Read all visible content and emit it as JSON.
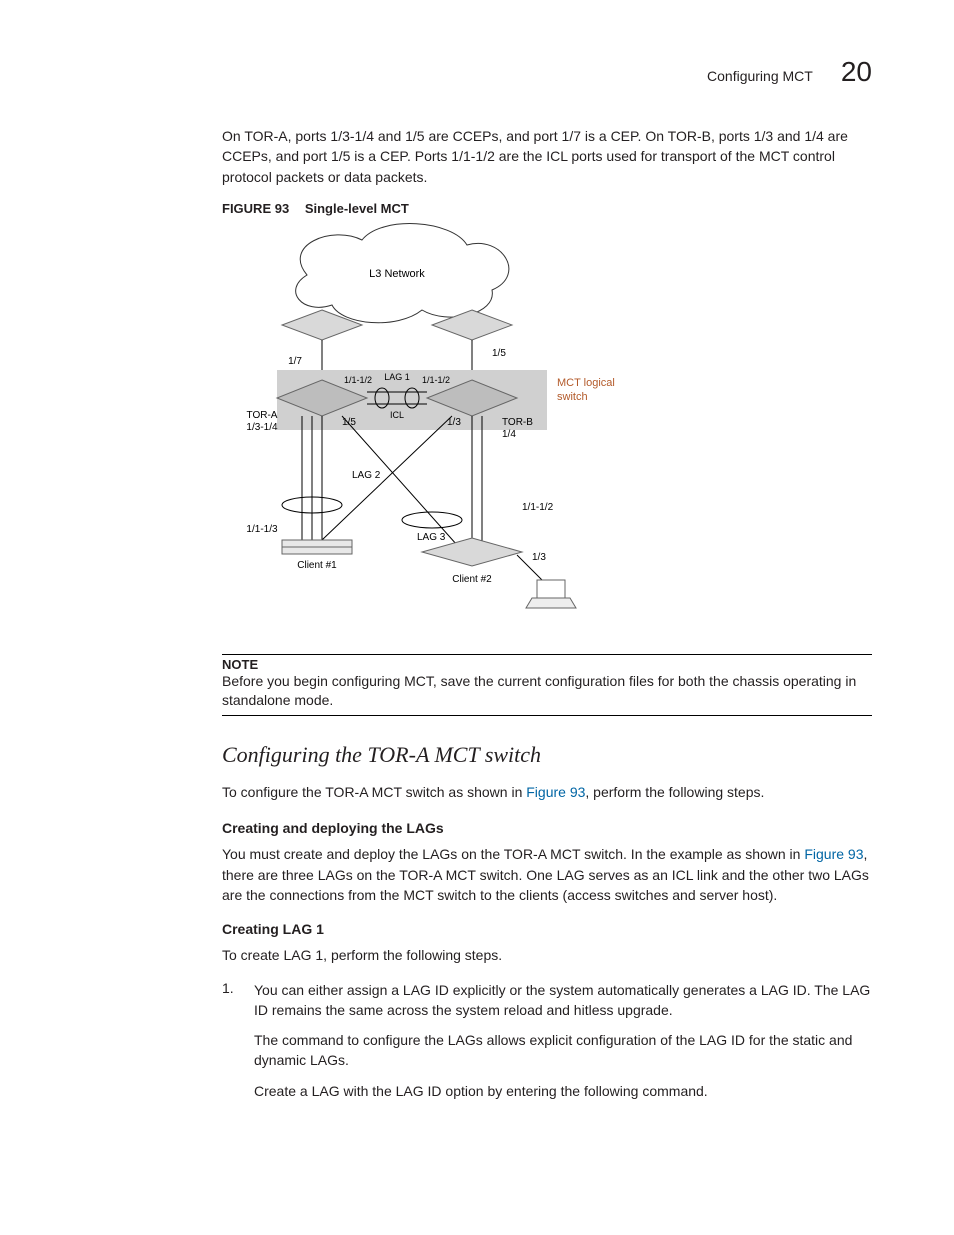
{
  "header": {
    "section_title": "Configuring MCT",
    "chapter_number": "20"
  },
  "intro_para": "On TOR-A, ports 1/3-1/4 and 1/5 are CCEPs, and port 1/7 is a CEP. On TOR-B, ports 1/3 and 1/4 are CCEPs, and port 1/5 is a CEP. Ports 1/1-1/2 are the ICL ports used for transport of the MCT control protocol packets or data packets.",
  "figure": {
    "label": "FIGURE 93",
    "title": "Single-level MCT",
    "labels": {
      "l3": "L3 Network",
      "p17": "1/7",
      "p15_top": "1/5",
      "icl_left": "1/1-1/2",
      "icl_right": "1/1-1/2",
      "lag1": "LAG 1",
      "icl": "ICL",
      "mct_logical": "MCT logical switch",
      "tor_a": "TOR-A",
      "tor_a_ports": "1/3-1/4",
      "p15_left": "1/5",
      "p13": "1/3",
      "tor_b": "TOR-B",
      "tor_b_port": "1/4",
      "lag2": "LAG 2",
      "lag3": "LAG 3",
      "c1_ports": "1/1-1/3",
      "c2_ports": "1/1-1/2",
      "p13_host": "1/3",
      "client1": "Client #1",
      "client2": "Client #2"
    }
  },
  "note": {
    "label": "NOTE",
    "text": "Before you begin configuring MCT, save the current configuration files for both the chassis operating in standalone mode."
  },
  "h2": "Configuring the TOR-A MCT switch",
  "h2_para_pre": "To configure the TOR-A MCT switch as shown in ",
  "h2_para_link": "Figure 93",
  "h2_para_post": ", perform the following steps.",
  "h3": "Creating and deploying the LAGs",
  "h3_para_pre": "You must create and deploy the LAGs on the TOR-A MCT switch. In the example as shown in ",
  "h3_para_link": "Figure 93",
  "h3_para_post": ", there are three LAGs on the TOR-A MCT switch. One LAG serves as an ICL link and the other two LAGs are the connections from the MCT switch to the clients (access switches and server host).",
  "h4": "Creating LAG 1",
  "h4_para": "To create LAG 1, perform the following steps.",
  "step1": {
    "num": "1.",
    "p1": "You can either assign a LAG ID explicitly or the system automatically generates a LAG ID. The LAG ID remains the same across the system reload and hitless upgrade.",
    "p2": "The command to configure the LAGs allows explicit configuration of the LAG ID for the static and dynamic LAGs.",
    "p3": "Create a LAG with the LAG ID option by entering the following command."
  }
}
